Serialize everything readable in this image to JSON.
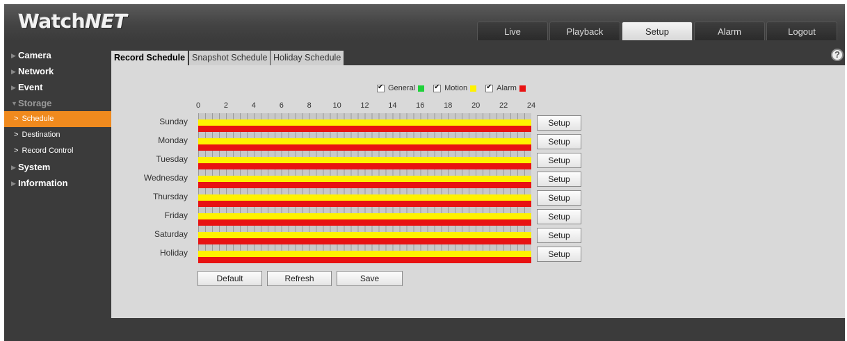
{
  "logo": {
    "part1": "Watch",
    "part2": "NET"
  },
  "nav": [
    "Live",
    "Playback",
    "Setup",
    "Alarm",
    "Logout"
  ],
  "sidebar": {
    "camera": "Camera",
    "network": "Network",
    "event": "Event",
    "storage": "Storage",
    "storage_items": [
      "Schedule",
      "Destination",
      "Record Control"
    ],
    "system": "System",
    "information": "Information"
  },
  "subtabs": [
    "Record Schedule",
    "Snapshot Schedule",
    "Holiday Schedule"
  ],
  "help_label": "?",
  "legend": [
    {
      "label": "General",
      "color": "#1fd13a"
    },
    {
      "label": "Motion",
      "color": "#fff200"
    },
    {
      "label": "Alarm",
      "color": "#e81212"
    }
  ],
  "hours": [
    "0",
    "2",
    "4",
    "6",
    "8",
    "10",
    "12",
    "14",
    "16",
    "18",
    "20",
    "22",
    "24"
  ],
  "days": [
    "Sunday",
    "Monday",
    "Tuesday",
    "Wednesday",
    "Thursday",
    "Friday",
    "Saturday",
    "Holiday"
  ],
  "setup_label": "Setup",
  "buttons": {
    "default": "Default",
    "refresh": "Refresh",
    "save": "Save"
  }
}
